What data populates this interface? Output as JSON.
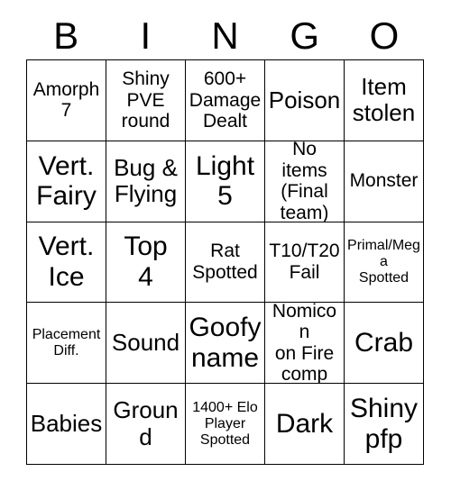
{
  "header": {
    "letters": [
      "B",
      "I",
      "N",
      "G",
      "O"
    ]
  },
  "grid": {
    "columns": 5,
    "rows": 5,
    "cells": [
      {
        "text": "Amorph\n7",
        "size": "md"
      },
      {
        "text": "Shiny\nPVE\nround",
        "size": "md"
      },
      {
        "text": "600+\nDamage\nDealt",
        "size": "md"
      },
      {
        "text": "Poison",
        "size": "lg"
      },
      {
        "text": "Item\nstolen",
        "size": "lg"
      },
      {
        "text": "Vert.\nFairy",
        "size": "xl"
      },
      {
        "text": "Bug &\nFlying",
        "size": "lg"
      },
      {
        "text": "Light\n5",
        "size": "xl"
      },
      {
        "text": "No items\n(Final\nteam)",
        "size": "md"
      },
      {
        "text": "Monster",
        "size": "md"
      },
      {
        "text": "Vert.\nIce",
        "size": "xl"
      },
      {
        "text": "Top\n4",
        "size": "xl"
      },
      {
        "text": "Rat\nSpotted",
        "size": "md"
      },
      {
        "text": "T10/T20\nFail",
        "size": "md"
      },
      {
        "text": "Primal/Mega\nSpotted",
        "size": "sm"
      },
      {
        "text": "Placement\nDiff.",
        "size": "sm"
      },
      {
        "text": "Sound",
        "size": "lg"
      },
      {
        "text": "Goofy\nname",
        "size": "xl"
      },
      {
        "text": "Nomicon\non Fire\ncomp",
        "size": "md"
      },
      {
        "text": "Crab",
        "size": "xl"
      },
      {
        "text": "Babies",
        "size": "lg"
      },
      {
        "text": "Ground",
        "size": "lg"
      },
      {
        "text": "1400+ Elo\nPlayer\nSpotted",
        "size": "sm"
      },
      {
        "text": "Dark",
        "size": "xl"
      },
      {
        "text": "Shiny\npfp",
        "size": "xl"
      }
    ]
  },
  "colors": {
    "background": "#ffffff",
    "text": "#000000",
    "grid_line": "#000000"
  }
}
